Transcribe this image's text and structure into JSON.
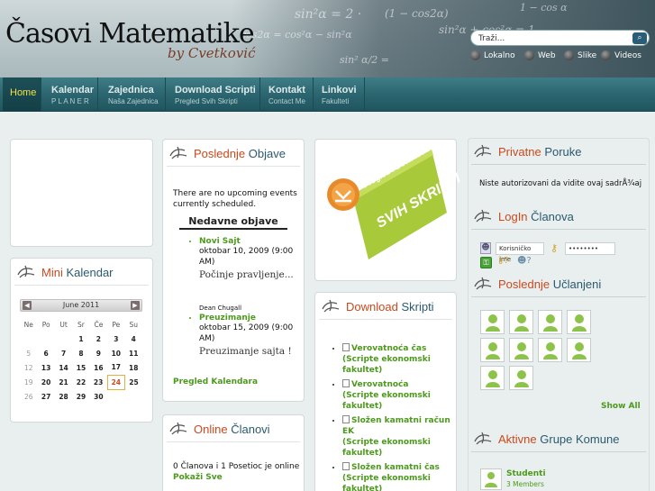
{
  "header": {
    "site_title": "Časovi Matematike",
    "site_subtitle": "by Cvetković",
    "chalk": [
      "sin²α = 2 ·",
      "(1 − cos2α)",
      "sin²α + cos²α = 1",
      "cos2α = cos²α − sin²α",
      "1 − cos α",
      "sin² α/2 ="
    ]
  },
  "search": {
    "value": "Traži...",
    "options": [
      "Lokalno",
      "Web",
      "Slike",
      "Videos"
    ]
  },
  "nav": [
    {
      "title": "Home",
      "sub": ""
    },
    {
      "title": "Kalendar",
      "sub": "P L A N E R"
    },
    {
      "title": "Zajednica",
      "sub": "Naša Zajednica"
    },
    {
      "title": "Download Scripti",
      "sub": "Pregled Svih Skripti"
    },
    {
      "title": "Kontakt",
      "sub": "Contact Me"
    },
    {
      "title": "Linkovi",
      "sub": "Fakulteti"
    }
  ],
  "mini_kalendar": {
    "title_a": "Mini",
    "title_b": "Kalendar",
    "month": "June 2011",
    "dow": [
      "Ne",
      "Po",
      "Ut",
      "Sr",
      "Če",
      "Pe",
      "Su"
    ],
    "weeks": [
      [
        "",
        "",
        "",
        "1",
        "2",
        "3",
        "4"
      ],
      [
        "5",
        "6",
        "7",
        "8",
        "9",
        "10",
        "11"
      ],
      [
        "12",
        "13",
        "14",
        "15",
        "16",
        "17",
        "18"
      ],
      [
        "19",
        "20",
        "21",
        "22",
        "23",
        "24",
        "25"
      ],
      [
        "26",
        "27",
        "28",
        "29",
        "30",
        "",
        ""
      ]
    ],
    "today": "24"
  },
  "poslednje_objave": {
    "title_a": "Poslednje",
    "title_b": "Objave",
    "no_events": "There are no upcoming events currently scheduled.",
    "heading": "Nedavne objave",
    "items": [
      {
        "title": "Novi Sajt",
        "date": "oktobar 10, 2009 (9:00 AM)",
        "excerpt": "Počinje pravljenje...",
        "author": "Dean Chugall"
      },
      {
        "title": "Preuzimanje",
        "date": "oktobar 15, 2009 (9:00 AM)",
        "excerpt": "Preuzimanje sajta !"
      }
    ],
    "footer_link": "Pregled Kalendara"
  },
  "online_clanovi": {
    "title_a": "Online",
    "title_b": "Članovi",
    "text": "0 Članova i 1 Posetioc je online",
    "link": "Pokaži Sve"
  },
  "promo": {
    "line1": "Pregled i Download",
    "line2": "SVIH SKRIPTI"
  },
  "download_skripti": {
    "title_a": "Download",
    "title_b": "Skripti",
    "items": [
      {
        "name": "Verovatnoća čas",
        "cat": "(Scripte ekonomski fakultet)"
      },
      {
        "name": "Verovatnoća",
        "cat": "(Scripte ekonomski fakultet)"
      },
      {
        "name": "Složen kamatni račun EK",
        "cat": "(Scripte ekonomski fakultet)"
      },
      {
        "name": "Složen kamatni čas",
        "cat": "(Scripte ekonomski fakultet)"
      }
    ]
  },
  "privatne_poruke": {
    "title_a": "Privatne",
    "title_b": "Poruke",
    "text": "Niste autorizovani da vidite ovaj sadrÅ¾aj"
  },
  "login": {
    "title_a": "LogIn",
    "title_b": "Članova",
    "username_placeholder": "Korisničko ime",
    "password_value": "••••••••"
  },
  "poslednje_uclanjeni": {
    "title_a": "Poslednje",
    "title_b": "Učlanjeni",
    "member_count": 10,
    "show_all": "Show All"
  },
  "aktivne_grupe": {
    "title_a": "Aktivne",
    "title_b": "Grupe Komune",
    "group_name": "Studenti",
    "group_members": "3 Members"
  },
  "colors": {
    "accent_orange": "#c9491d",
    "title_blue": "#2b5a6e",
    "link_green": "#4c9a1c",
    "nav_teal": "#2c6670",
    "promo_green": "#a7c93a",
    "home_yellow": "#f1e24a"
  }
}
